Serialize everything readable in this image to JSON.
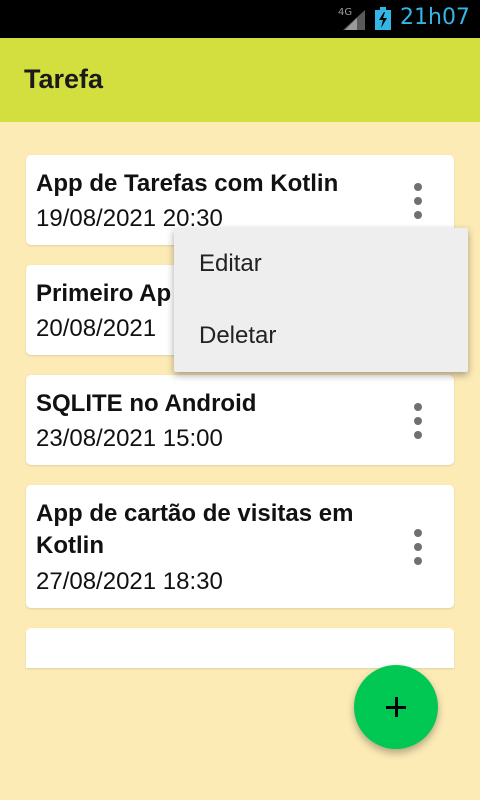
{
  "status_bar": {
    "network": "4G",
    "time": "21h07",
    "signal_icon": "signal-icon",
    "battery_icon": "battery-charging-icon"
  },
  "app_bar": {
    "title": "Tarefa",
    "background_color": "#d2df3e"
  },
  "tasks": [
    {
      "title": "App de Tarefas com Kotlin",
      "date": "19/08/2021 20:30"
    },
    {
      "title": "Primeiro Ap",
      "date": "20/08/2021"
    },
    {
      "title": "SQLITE no Android",
      "date": "23/08/2021 15:00"
    },
    {
      "title": "App de cartão de visitas em Kotlin",
      "date": "27/08/2021 18:30"
    }
  ],
  "popup_menu": {
    "items": [
      {
        "label": "Editar"
      },
      {
        "label": "Deletar"
      }
    ]
  },
  "fab": {
    "icon": "plus-icon",
    "color": "#00c853"
  },
  "colors": {
    "background": "#fdebb6",
    "status_clock": "#33b5e5"
  }
}
